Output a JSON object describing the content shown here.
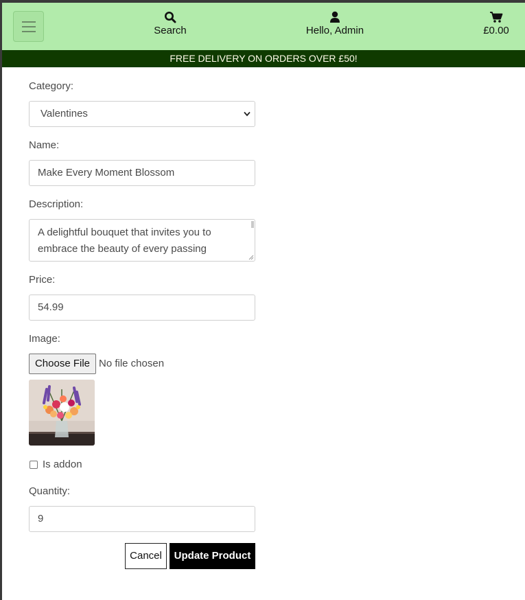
{
  "header": {
    "menu_icon": "hamburger-icon",
    "search": {
      "icon": "search-icon",
      "label": "Search"
    },
    "account": {
      "icon": "user-icon",
      "label": "Hello, Admin"
    },
    "bag": {
      "icon": "cart-icon",
      "label": "£0.00"
    },
    "colors": {
      "navbar": "#b2ebab",
      "banner": "#0f3a00"
    }
  },
  "banner": {
    "text": "FREE DELIVERY ON ORDERS OVER £50!"
  },
  "form": {
    "category": {
      "label": "Category:",
      "selected": "Valentines"
    },
    "name": {
      "label": "Name:",
      "value": "Make Every Moment Blossom"
    },
    "description": {
      "label": "Description:",
      "value": "A delightful bouquet that invites you to embrace the beauty of every passing"
    },
    "price": {
      "label": "Price:",
      "value": "54.99"
    },
    "image": {
      "label": "Image:",
      "choose_button": "Choose File",
      "status": "No file chosen",
      "preview": "flower-bouquet-image"
    },
    "addon": {
      "label": "Is addon",
      "checked": false
    },
    "quantity": {
      "label": "Quantity:",
      "value": "9"
    },
    "cancel_label": "Cancel",
    "submit_label": "Update Product"
  }
}
